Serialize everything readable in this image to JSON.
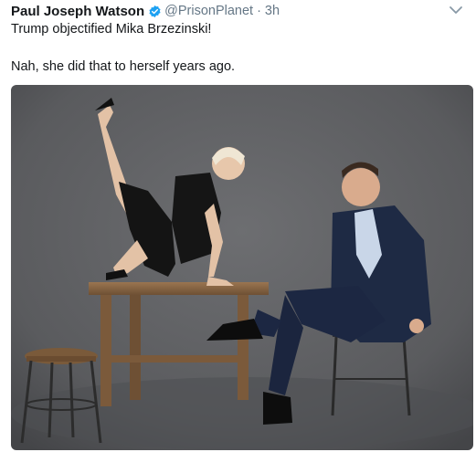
{
  "tweet": {
    "author_name": "Paul Joseph Watson",
    "handle": "@PrisonPlanet",
    "separator": "·",
    "time": "3h",
    "text_line1": "Trump objectified Mika Brzezinski!",
    "text_line2": "Nah, she did that to herself years ago.",
    "verified": true
  },
  "colors": {
    "verified_badge": "#1da1f2",
    "muted_text": "#657786",
    "backdrop": "#5f6063"
  },
  "icons": {
    "verified": "verified-badge-icon",
    "menu": "chevron-down-icon"
  }
}
